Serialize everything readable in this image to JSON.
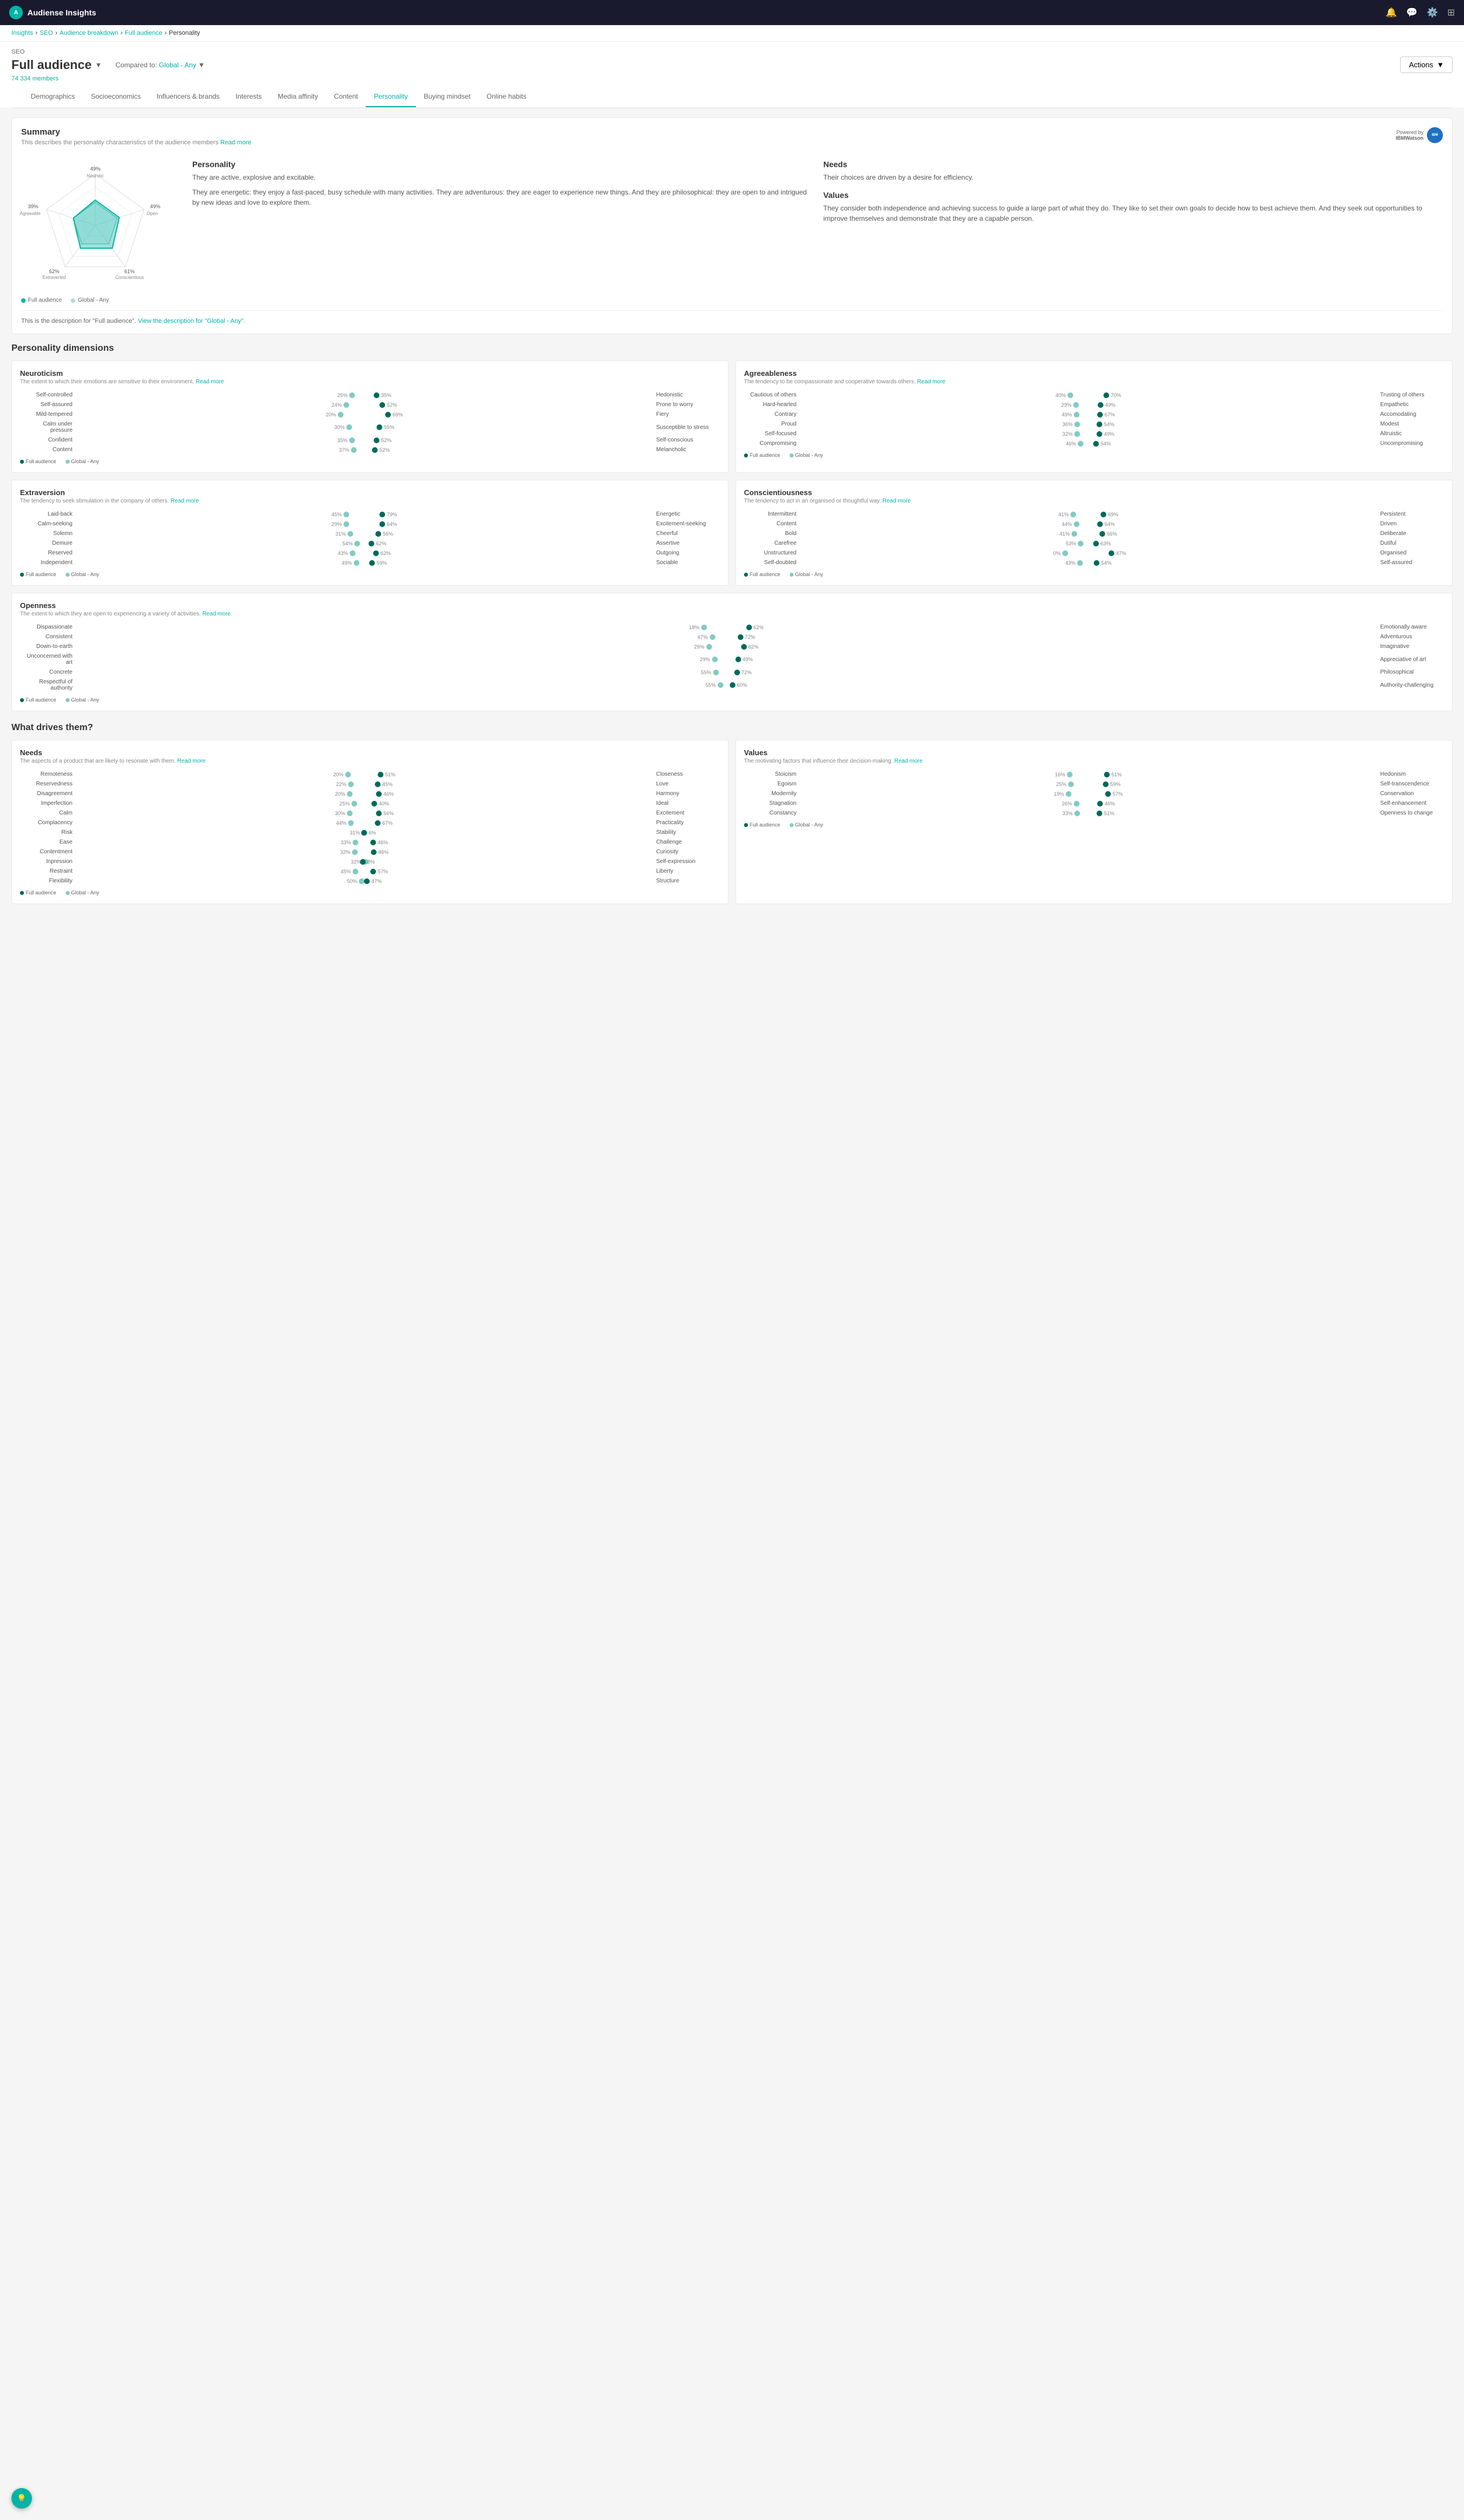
{
  "header": {
    "title": "Audiense Insights",
    "logo_text": "A"
  },
  "breadcrumb": {
    "items": [
      "Insights",
      "SEO",
      "Audience breakdown",
      "Full audience",
      "Personality"
    ]
  },
  "page": {
    "label": "SEO",
    "audience": "Full audience",
    "compared_to": "Global - Any",
    "members": "74 334 members",
    "actions_label": "Actions"
  },
  "nav_tabs": [
    {
      "label": "Demographics",
      "active": false
    },
    {
      "label": "Socioeconomics",
      "active": false
    },
    {
      "label": "Influencers & brands",
      "active": false
    },
    {
      "label": "Interests",
      "active": false
    },
    {
      "label": "Media affinity",
      "active": false
    },
    {
      "label": "Content",
      "active": false
    },
    {
      "label": "Personality",
      "active": true
    },
    {
      "label": "Buying mindset",
      "active": false
    },
    {
      "label": "Online habits",
      "active": false
    }
  ],
  "summary": {
    "title": "Summary",
    "desc": "This describes the personality characteristics of the audience members",
    "read_more": "Read more",
    "ibm_label": "Powered by",
    "ibm_sublabel": "IBMWatson",
    "radar": {
      "labels": [
        "Neurotic",
        "Open",
        "Conscientious",
        "Extraverted",
        "Agreeable"
      ],
      "full_values": [
        49,
        49,
        61,
        52,
        39
      ],
      "global_values": [
        45,
        45,
        55,
        48,
        42
      ]
    },
    "personality": {
      "title": "Personality",
      "text1": "They are active, explosive and excitable.",
      "text2": "They are energetic: they enjoy a fast-paced, busy schedule with many activities. They are adventurous: they are eager to experience new things. And they are philosophical: they are open to and intrigued by new ideas and love to explore them."
    },
    "needs": {
      "title": "Needs",
      "text": "Their choices are driven by a desire for efficiency."
    },
    "values": {
      "title": "Values",
      "text": "They consider both independence and achieving success to guide a large part of what they do. They like to set their own goals to decide how to best achieve them. And they seek out opportunities to improve themselves and demonstrate that they are a capable person."
    },
    "footer": "This is the description for \"Full audience\".",
    "footer_link": "View the description for \"Global - Any\".",
    "legend_full": "Full audience",
    "legend_global": "Global - Any"
  },
  "personality_dimensions": {
    "section_title": "Personality dimensions",
    "neuroticism": {
      "title": "Neuroticism",
      "desc": "The extent to which their emotions are sensitive to their environment.",
      "read_more": "Read more",
      "traits": [
        {
          "left": "Self-controlled",
          "left_pct": "25%",
          "right_pct": "35%",
          "right": "Hedonistic"
        },
        {
          "left": "Self-assured",
          "left_pct": "24%",
          "right_pct": "52%",
          "right": "Prone to worry"
        },
        {
          "left": "Mild-tempered",
          "left_pct": "20%",
          "right_pct": "69%",
          "right": "Fiery"
        },
        {
          "left": "Calm under pressure",
          "left_pct": "30%",
          "right_pct": "55%",
          "right": "Susceptible to stress"
        },
        {
          "left": "Confident",
          "left_pct": "35%",
          "right_pct": "52%",
          "right": "Self-conscious"
        },
        {
          "left": "Content",
          "left_pct": "37%",
          "right_pct": "52%",
          "right": "Melancholic"
        }
      ]
    },
    "agreeableness": {
      "title": "Agreeableness",
      "desc": "The tendency to be compassionate and cooperative towards others.",
      "read_more": "Read more",
      "traits": [
        {
          "left": "Cautious of others",
          "left_pct": "40%",
          "right_pct": "70%",
          "right": "Trusting of others"
        },
        {
          "left": "Hard-hearted",
          "left_pct": "29%",
          "right_pct": "49%",
          "right": "Empathetic"
        },
        {
          "left": "Contrary",
          "left_pct": "49%",
          "right_pct": "67%",
          "right": "Accomodating"
        },
        {
          "left": "Proud",
          "left_pct": "36%",
          "right_pct": "54%",
          "right": "Modest"
        },
        {
          "left": "Self-focused",
          "left_pct": "32%",
          "right_pct": "49%",
          "right": "Altruistic"
        },
        {
          "left": "Compromising",
          "left_pct": "46%",
          "right_pct": "54%",
          "right": "Uncompromising"
        }
      ]
    },
    "extraversion": {
      "title": "Extraversion",
      "desc": "The tendency to seek stimulation in the company of others.",
      "read_more": "Read more",
      "traits": [
        {
          "left": "Laid-back",
          "left_pct": "45%",
          "right_pct": "79%",
          "right": "Energetic"
        },
        {
          "left": "Calm-seeking",
          "left_pct": "29%",
          "right_pct": "64%",
          "right": "Excitement-seeking"
        },
        {
          "left": "Solemn",
          "left_pct": "31%",
          "right_pct": "56%",
          "right": "Cheerful"
        },
        {
          "left": "Demure",
          "left_pct": "54%",
          "right_pct": "62%",
          "right": "Assertive"
        },
        {
          "left": "Reserved",
          "left_pct": "43%",
          "right_pct": "62%",
          "right": "Outgoing"
        },
        {
          "left": "Independent",
          "left_pct": "49%",
          "right_pct": "59%",
          "right": "Sociable"
        }
      ]
    },
    "conscientiousness": {
      "title": "Conscientiousness",
      "desc": "The tendency to act in an organised or thoughtful way.",
      "read_more": "Read more",
      "traits": [
        {
          "left": "Intermittent",
          "left_pct": "41%",
          "right_pct": "69%",
          "right": "Persistent"
        },
        {
          "left": "Content",
          "left_pct": "44%",
          "right_pct": "64%",
          "right": "Driven"
        },
        {
          "left": "Bold",
          "left_pct": "41%",
          "right_pct": "66%",
          "right": "Deliberate"
        },
        {
          "left": "Carefree",
          "left_pct": "53%",
          "right_pct": "63%",
          "right": "Dutiful"
        },
        {
          "left": "Unstructured",
          "left_pct": "0%",
          "right_pct": "47%",
          "right": "Organised"
        },
        {
          "left": "Self-doubted",
          "left_pct": "43%",
          "right_pct": "54%",
          "right": "Self-assured"
        }
      ]
    },
    "openness": {
      "title": "Openness",
      "desc": "The extent to which they are open to experiencing a variety of activities.",
      "read_more": "Read more",
      "traits": [
        {
          "left": "Dispassionate",
          "left_pct": "18%",
          "right_pct": "62%",
          "right": "Emotionally aware"
        },
        {
          "left": "Consistent",
          "left_pct": "47%",
          "right_pct": "72%",
          "right": "Adventurous"
        },
        {
          "left": "Down-to-earth",
          "left_pct": "29%",
          "right_pct": "62%",
          "right": "Imaginative"
        },
        {
          "left": "Unconcerned with art",
          "left_pct": "29%",
          "right_pct": "49%",
          "right": "Appreciative of art"
        },
        {
          "left": "Concrete",
          "left_pct": "55%",
          "right_pct": "72%",
          "right": "Philosophical"
        },
        {
          "left": "Respectful of authority",
          "left_pct": "55%",
          "right_pct": "60%",
          "right": "Authority-challenging"
        }
      ]
    }
  },
  "what_drives": {
    "section_title": "What drives them?",
    "needs": {
      "title": "Needs",
      "desc": "The aspects of a product that are likely to resonate with them.",
      "read_more": "Read more",
      "traits": [
        {
          "left": "Remoteness",
          "left_pct": "20%",
          "right_pct": "51%",
          "right": "Closeness"
        },
        {
          "left": "Reservedness",
          "left_pct": "22%",
          "right_pct": "45%",
          "right": "Love"
        },
        {
          "left": "Disagreement",
          "left_pct": "20%",
          "right_pct": "46%",
          "right": "Harmony"
        },
        {
          "left": "Imperfection",
          "left_pct": "25%",
          "right_pct": "40%",
          "right": "Ideal"
        },
        {
          "left": "Calm",
          "left_pct": "30%",
          "right_pct": "56%",
          "right": "Excitement"
        },
        {
          "left": "Complacency",
          "left_pct": "44%",
          "right_pct": "67%",
          "right": "Practicality"
        },
        {
          "left": "Risk",
          "left_pct": "31%",
          "right_pct": "6%",
          "right": "Stability"
        },
        {
          "left": "Ease",
          "left_pct": "33%",
          "right_pct": "46%",
          "right": "Challenge"
        },
        {
          "left": "Contentment",
          "left_pct": "32%",
          "right_pct": "46%",
          "right": "Curiosity"
        },
        {
          "left": "Inpression",
          "left_pct": "32%",
          "right_pct": "8%",
          "right": "Self-expression"
        },
        {
          "left": "Restraint",
          "left_pct": "45%",
          "right_pct": "57%",
          "right": "Liberty"
        },
        {
          "left": "Flexibility",
          "left_pct": "50%",
          "right_pct": "47%",
          "right": "Structure"
        }
      ]
    },
    "values": {
      "title": "Values",
      "desc": "The motivating factors that influence their decision-making.",
      "read_more": "Read more",
      "traits": [
        {
          "left": "Stoicism",
          "left_pct": "16%",
          "right_pct": "51%",
          "right": "Hedonism"
        },
        {
          "left": "Egoism",
          "left_pct": "25%",
          "right_pct": "59%",
          "right": "Self-transcendence"
        },
        {
          "left": "Modernity",
          "left_pct": "19%",
          "right_pct": "57%",
          "right": "Conservation"
        },
        {
          "left": "Stagnation",
          "left_pct": "26%",
          "right_pct": "46%",
          "right": "Self-enhancement"
        },
        {
          "left": "Constancy",
          "left_pct": "33%",
          "right_pct": "51%",
          "right": "Openness to change"
        }
      ]
    }
  }
}
